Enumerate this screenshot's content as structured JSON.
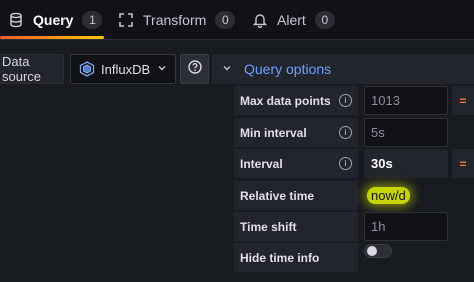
{
  "tabs": [
    {
      "label": "Query",
      "count": "1",
      "icon": "database-icon"
    },
    {
      "label": "Transform",
      "count": "0",
      "icon": "transform-icon"
    },
    {
      "label": "Alert",
      "count": "0",
      "icon": "bell-icon"
    }
  ],
  "datasource": {
    "label": "Data source",
    "selected": "InfluxDB",
    "icon": "influxdb-icon"
  },
  "query_options": {
    "title": "Query options",
    "rows": [
      {
        "label": "Max data points",
        "value": "1013",
        "has_info": true
      },
      {
        "label": "Min interval",
        "value": "5s",
        "has_info": true
      },
      {
        "label": "Interval",
        "value": "30s",
        "has_info": true
      },
      {
        "label": "Relative time",
        "value": "now/d"
      },
      {
        "label": "Time shift",
        "value": "1h"
      },
      {
        "label": "Hide time info",
        "toggle_on": false
      }
    ],
    "eq_symbol": "="
  },
  "colors": {
    "accent_blue": "#6e9fff",
    "highlight": "#c8d400",
    "tab_gradient_start": "#f05a28",
    "tab_gradient_end": "#fbca0a"
  }
}
